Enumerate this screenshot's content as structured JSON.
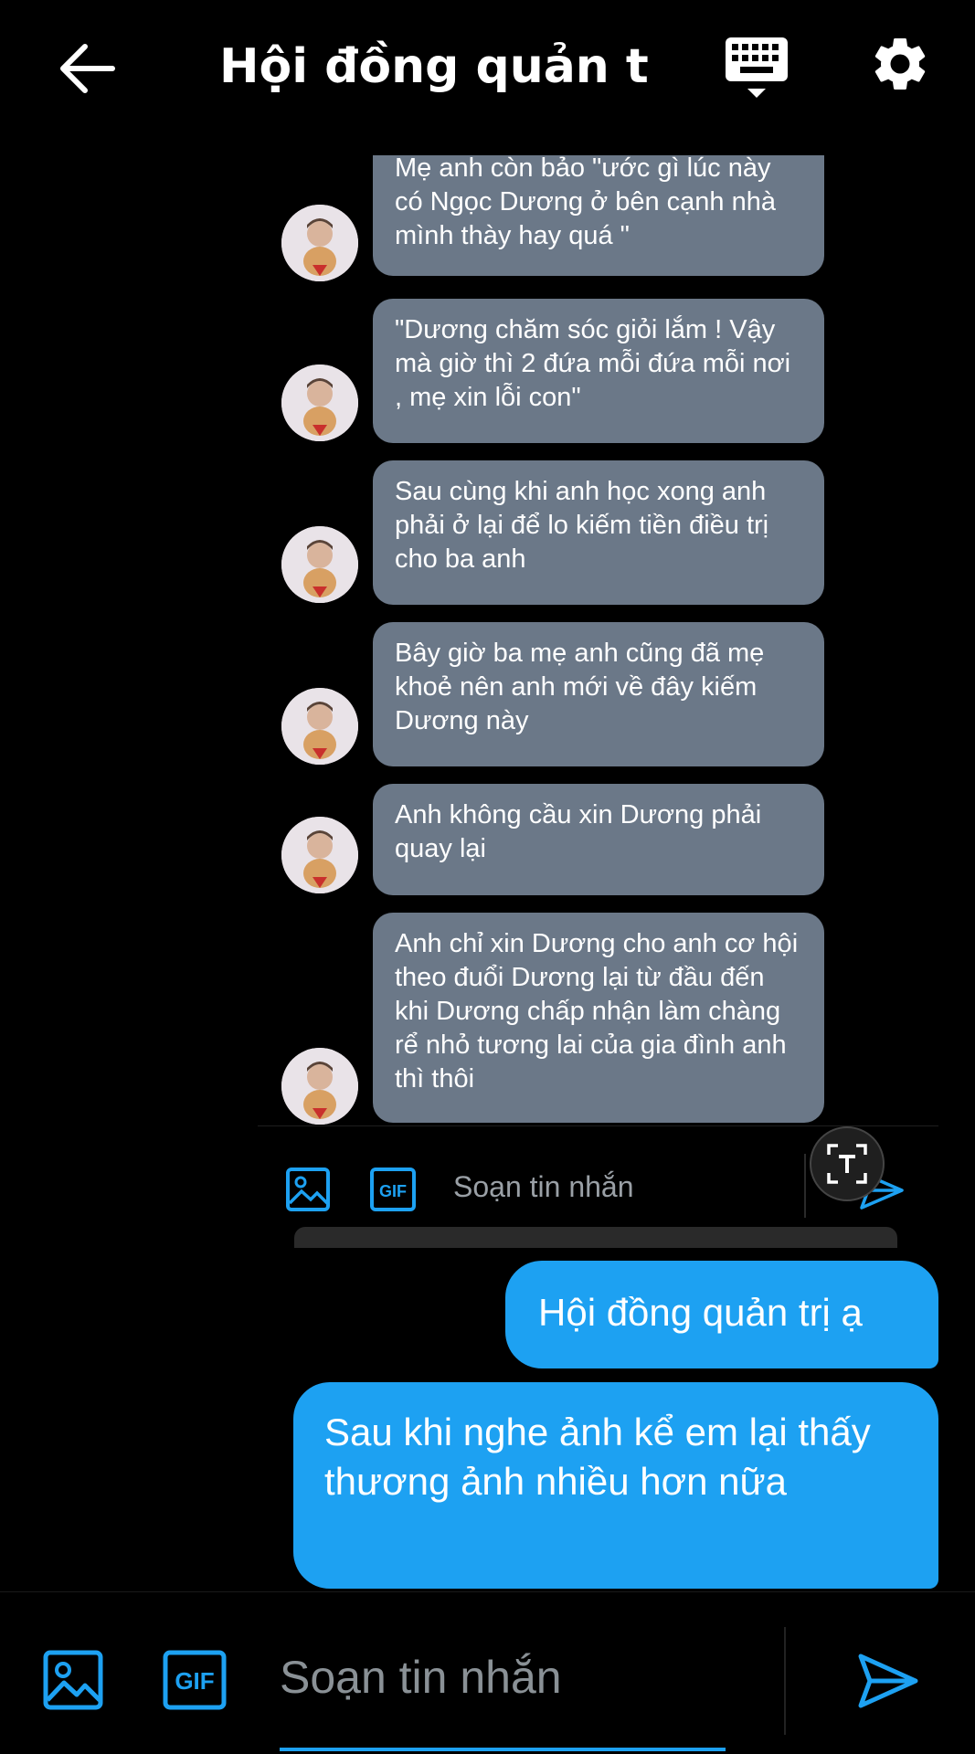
{
  "header": {
    "title": "Hội đồng quản tr..."
  },
  "embedded_chat": {
    "messages": [
      {
        "text": "Mẹ anh còn bảo \"ước gì lúc này có Ngọc Dương ở bên cạnh nhà mình thày hay quá \""
      },
      {
        "text": "\"Dương chăm sóc giỏi lắm ! Vậy mà giờ thì 2 đứa mỗi đứa mỗi nơi , mẹ xin lỗi con\""
      },
      {
        "text": "Sau cùng khi anh học xong anh phải ở lại để lo kiếm tiền điều trị cho ba anh"
      },
      {
        "text": "Bây giờ ba mẹ anh cũng đã mẹ khoẻ nên anh mới về đây kiếm Dương này"
      },
      {
        "text": "Anh không cầu xin Dương phải quay lại"
      },
      {
        "text": "Anh chỉ xin Dương cho anh cơ hội theo đuổi Dương lại từ đầu đến khi Dương chấp nhận làm chàng rể nhỏ tương lai của gia đình anh thì thôi"
      }
    ],
    "input_placeholder": "Soạn tin nhắn",
    "gif_label": "GIF"
  },
  "outgoing": [
    {
      "text": "Hội đồng quản trị ạ"
    },
    {
      "text": "Sau khi nghe ảnh kể em lại thấy thương ảnh nhiều hơn nữa"
    }
  ],
  "composer": {
    "placeholder": "Soạn tin nhắn",
    "gif_label": "GIF"
  },
  "colors": {
    "accent": "#1da1f2",
    "incoming_bubble": "#6b7888",
    "background": "#000000"
  },
  "icons": [
    "back-arrow-icon",
    "keyboard-icon",
    "settings-gear-icon",
    "image-icon",
    "gif-icon",
    "send-icon",
    "text-scan-icon",
    "avatar"
  ]
}
